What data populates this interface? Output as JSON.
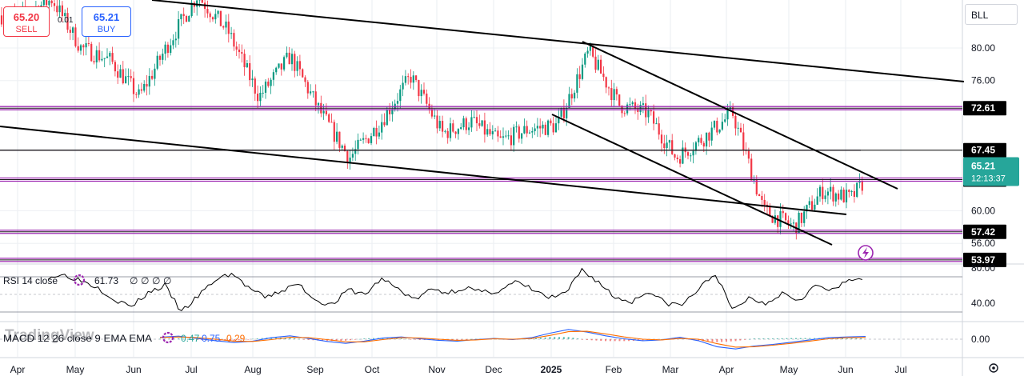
{
  "symbol": "BLL",
  "quote": {
    "sell_price": "65.20",
    "sell_label": "SELL",
    "spread": "0.01",
    "buy_price": "65.21",
    "buy_label": "BUY"
  },
  "watermark": "TradingView",
  "colors": {
    "up": "#089981",
    "down": "#f23645",
    "level": "#9c27b0",
    "trendline": "#000000",
    "rsi": "#000000",
    "macd": "#2962ff",
    "signal": "#ff6d00",
    "price_tag": "#26a69a"
  },
  "icons": {
    "flash": "flash-icon",
    "settings": "gear-icon",
    "rsi_settings": "settings-icon",
    "macd_settings": "settings-icon"
  },
  "chart_data": [
    {
      "type": "candlestick",
      "title": "",
      "x_ticks": [
        "Apr",
        "May",
        "Jun",
        "Jul",
        "Aug",
        "Sep",
        "Oct",
        "Nov",
        "Dec",
        "2025",
        "Feb",
        "Mar",
        "Apr",
        "May",
        "Jun",
        "Jul"
      ],
      "y_ticks": [
        "80.00",
        "76.00",
        "60.00",
        "56.00"
      ],
      "ylim": [
        52.8,
        88.5
      ],
      "grid": true,
      "current_price": {
        "value": 65.21,
        "label": "65.21",
        "countdown": "12:13:37"
      },
      "horizontal_levels": [
        {
          "value": 72.61,
          "label": "72.61"
        },
        {
          "value": 67.45,
          "label": "67.45"
        },
        {
          "value": 63.83,
          "label": "63.83"
        },
        {
          "value": 57.42,
          "label": "57.42"
        },
        {
          "value": 53.97,
          "label": "53.97"
        }
      ],
      "price_path": [
        [
          "Apr",
          84.0
        ],
        [
          "Apr",
          86.0
        ],
        [
          "May",
          80.0
        ],
        [
          "May",
          78.5
        ],
        [
          "Jun",
          74.0
        ],
        [
          "Jun",
          80.5
        ],
        [
          "Jul",
          86.5
        ],
        [
          "Jul",
          82.0
        ],
        [
          "Aug",
          74.0
        ],
        [
          "Aug",
          79.0
        ],
        [
          "Sep",
          72.0
        ],
        [
          "Sep",
          66.5
        ],
        [
          "Oct",
          70.5
        ],
        [
          "Oct",
          76.5
        ],
        [
          "Nov",
          69.5
        ],
        [
          "Nov",
          71.0
        ],
        [
          "Dec",
          68.5
        ],
        [
          "Dec",
          70.0
        ],
        [
          "2025",
          70.5
        ],
        [
          "2025",
          79.5
        ],
        [
          "Feb",
          73.0
        ],
        [
          "Feb",
          72.0
        ],
        [
          "Mar",
          66.5
        ],
        [
          "Mar",
          69.0
        ],
        [
          "Apr",
          72.0
        ],
        [
          "Apr",
          60.0
        ],
        [
          "May",
          58.0
        ],
        [
          "May",
          62.5
        ],
        [
          "Jun",
          61.5
        ],
        [
          "Jun",
          66.0
        ]
      ]
    },
    {
      "type": "line",
      "title": "RSI 14 close",
      "value_label": "61.73",
      "extra_labels": [
        "∅",
        "∅",
        "∅",
        "∅"
      ],
      "y_ticks": [
        "80.00",
        "40.00"
      ],
      "ylim": [
        20,
        87
      ],
      "series": [
        {
          "name": "RSI",
          "values": [
            70,
            72,
            66,
            58,
            44,
            36,
            52,
            60,
            30,
            48,
            66,
            74,
            58,
            46,
            54,
            62,
            44,
            38,
            55,
            50,
            68,
            56,
            44,
            56,
            52,
            58,
            52,
            54,
            64,
            56,
            46,
            50,
            78,
            64,
            46,
            42,
            54,
            40,
            38,
            56,
            74,
            32,
            46,
            40,
            52,
            44,
            60,
            54,
            66,
            70
          ]
        }
      ]
    },
    {
      "type": "line",
      "title": "MACD 12 26 close 9 EMA EMA",
      "value_labels": [
        "0.47",
        "0.75",
        "0.29"
      ],
      "y_ticks": [
        "0.00"
      ],
      "ylim": [
        -3.2,
        3.2
      ],
      "series": [
        {
          "name": "MACD",
          "values": [
            0.5,
            0.8,
            0.2,
            -0.4,
            -0.9,
            -0.5,
            0.4,
            0.9,
            0.2,
            -0.6,
            -1.1,
            -0.5,
            0.3,
            0.6,
            0.1,
            -0.3,
            -0.5,
            -0.1,
            0.2,
            -0.1,
            0.4,
            1.6,
            2.6,
            1.9,
            0.9,
            0.1,
            -0.4,
            -0.2,
            0.5,
            -0.4,
            -2.0,
            -2.6,
            -1.8,
            -1.4,
            -0.8,
            -0.2,
            0.4,
            0.6,
            0.75
          ]
        },
        {
          "name": "Signal",
          "values": [
            0.4,
            0.6,
            0.4,
            0.0,
            -0.5,
            -0.6,
            -0.1,
            0.5,
            0.4,
            -0.1,
            -0.7,
            -0.7,
            -0.1,
            0.4,
            0.3,
            0.0,
            -0.3,
            -0.2,
            0.1,
            0.0,
            0.2,
            1.0,
            2.0,
            2.1,
            1.4,
            0.6,
            0.0,
            -0.2,
            0.2,
            0.0,
            -1.2,
            -2.1,
            -2.0,
            -1.6,
            -1.1,
            -0.5,
            0.1,
            0.4,
            0.47
          ]
        }
      ],
      "histogram": {
        "name": "Histogram",
        "last": 0.29
      }
    }
  ]
}
